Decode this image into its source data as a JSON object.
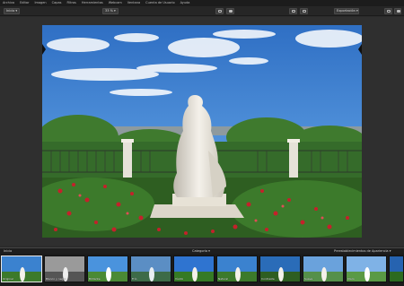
{
  "menubar": {
    "items": [
      "Archivo",
      "Editar",
      "Imagen",
      "Capas",
      "Filtros",
      "Herramientas",
      "Webcam",
      "Ventana",
      "Cuenta de Usuario",
      "Ayuda"
    ]
  },
  "toolbar": {
    "preset_label": "Inicio ▾",
    "zoom_label": "33 % ▾",
    "export_label": "Exportación ▾"
  },
  "photo": {
    "subject": "white marble statue in a garden with red roses under blue sky"
  },
  "filmbar": {
    "left_label": "Inicio",
    "center_label": "Categoría ▾",
    "right_label": "Preestablecimientos de Apariencia ▾"
  },
  "filmstrip": {
    "thumbnails": [
      {
        "caption": "Original",
        "style": "color",
        "active": true
      },
      {
        "caption": "Blanco y negro",
        "style": "bw",
        "active": false
      },
      {
        "caption": "Brillante",
        "style": "color",
        "active": false
      },
      {
        "caption": "Frío",
        "style": "cool",
        "active": false
      },
      {
        "caption": "Vívido",
        "style": "color",
        "active": false
      },
      {
        "caption": "Natural",
        "style": "color",
        "active": false
      },
      {
        "caption": "Contraste",
        "style": "cool",
        "active": false
      },
      {
        "caption": "Suave",
        "style": "color",
        "active": false
      },
      {
        "caption": "Claro",
        "style": "color",
        "active": false
      },
      {
        "caption": "Intenso",
        "style": "color",
        "active": false
      }
    ]
  },
  "colors": {
    "accent": "#e8c86a",
    "sky": "#3b82cf",
    "foliage": "#3f7a2e",
    "roses": "#c4212b"
  }
}
